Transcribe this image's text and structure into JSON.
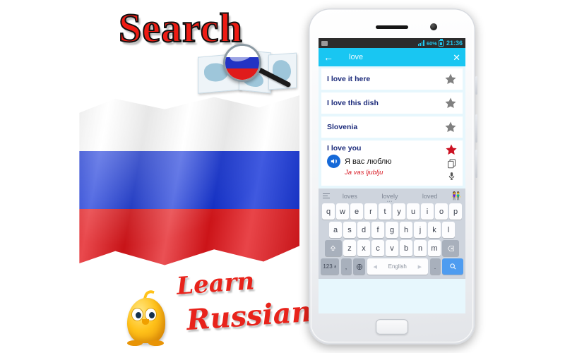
{
  "promo": {
    "title": "Search",
    "learn_line1": "Learn",
    "learn_line2": "Russian",
    "map_icon": "world-map-icon",
    "magnifier_icon": "magnifier-icon",
    "flag_icon": "russian-flag",
    "mascot_icon": "mascot-blob"
  },
  "phone": {
    "statusbar": {
      "battery_percent": "60%",
      "clock": "21:36",
      "signal_icon": "signal-bars-icon",
      "battery_icon": "battery-icon",
      "notification_icon": "sd-card-icon"
    },
    "appbar": {
      "back_icon": "back-arrow-icon",
      "query": "love",
      "close_icon": "close-x-icon"
    },
    "results": [
      {
        "label": "I love it here",
        "starred": false,
        "star_icon": "star-icon"
      },
      {
        "label": "I love this dish",
        "starred": false,
        "star_icon": "star-icon"
      },
      {
        "label": "Slovenia",
        "starred": false,
        "star_icon": "star-icon"
      }
    ],
    "expanded": {
      "title": "I love you",
      "translation": "Я вас люблю",
      "transliteration": "Ja vas ljublju",
      "speaker_icon": "speaker-icon",
      "star_icon": "star-filled-icon",
      "copy_icon": "copy-icon",
      "mic_icon": "microphone-icon",
      "starred": true
    },
    "keyboard": {
      "menu_icon": "hamburger-menu-icon",
      "suggestions": [
        "loves",
        "lovely",
        "loved"
      ],
      "emoji_icon": "emoji-icon",
      "row1": [
        "q",
        "w",
        "e",
        "r",
        "t",
        "y",
        "u",
        "i",
        "o",
        "p"
      ],
      "row2": [
        "a",
        "s",
        "d",
        "f",
        "g",
        "h",
        "j",
        "k",
        "l"
      ],
      "row3": [
        "z",
        "x",
        "c",
        "v",
        "b",
        "n",
        "m"
      ],
      "shift_icon": "shift-key-icon",
      "backspace_icon": "backspace-key-icon",
      "numeric_label": "123",
      "numeric_mic_icon": "mic-small-icon",
      "comma_label": ",",
      "globe_icon": "globe-key-icon",
      "space_label": "English",
      "period_label": ".",
      "search_icon": "search-key-icon"
    },
    "home_button_icon": "home-button"
  },
  "colors": {
    "accent_cyan": "#19c6f2",
    "promo_red": "#e8231b",
    "flag_blue": "#1030d8",
    "flag_red": "#e3161b",
    "card_text": "#1b2a7a",
    "translit_red": "#d9202a",
    "star_gray": "#808080",
    "star_red": "#cc1122",
    "keyboard_bg": "#ced4dd"
  }
}
